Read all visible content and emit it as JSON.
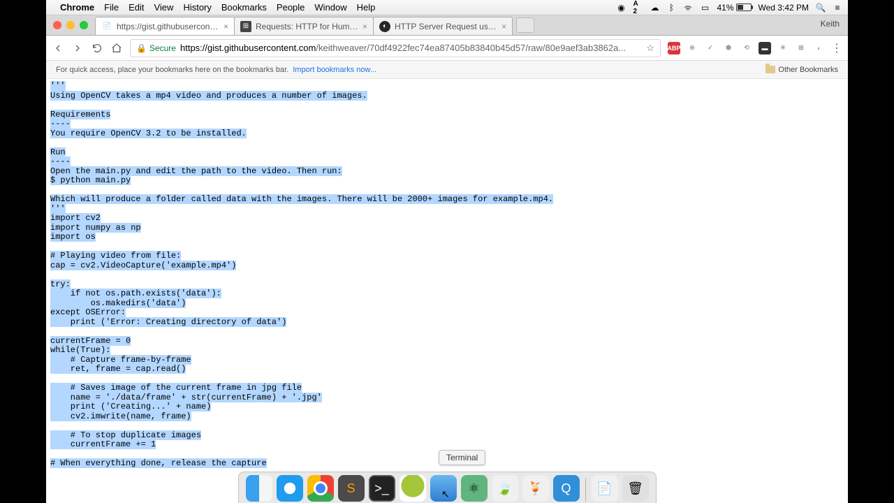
{
  "menubar": {
    "app": "Chrome",
    "items": [
      "File",
      "Edit",
      "View",
      "History",
      "Bookmarks",
      "People",
      "Window",
      "Help"
    ]
  },
  "status": {
    "battery_pct": "41%",
    "clock": "Wed 3:42 PM"
  },
  "tabs": [
    {
      "title": "https://gist.githubusercontent.",
      "active": true
    },
    {
      "title": "Requests: HTTP for Humans —",
      "active": false
    },
    {
      "title": "HTTP Server Request using Re",
      "active": false
    }
  ],
  "user_badge": "Keith",
  "nav": {
    "secure_label": "Secure",
    "url_host": "https://gist.githubusercontent.com",
    "url_path": "/keithweaver/70df4922fec74ea87405b83840b45d57/raw/80e9aef3ab3862a..."
  },
  "bookmarks": {
    "msg": "For quick access, place your bookmarks here on the bookmarks bar.",
    "link": "Import bookmarks now...",
    "other": "Other Bookmarks"
  },
  "code_lines": [
    "'''",
    "Using OpenCV takes a mp4 video and produces a number of images.",
    "",
    "Requirements",
    "----",
    "You require OpenCV 3.2 to be installed.",
    "",
    "Run",
    "----",
    "Open the main.py and edit the path to the video. Then run:",
    "$ python main.py",
    "",
    "Which will produce a folder called data with the images. There will be 2000+ images for example.mp4.",
    "'''",
    "import cv2",
    "import numpy as np",
    "import os",
    "",
    "# Playing video from file:",
    "cap = cv2.VideoCapture('example.mp4')",
    "",
    "try:",
    "    if not os.path.exists('data'):",
    "        os.makedirs('data')",
    "except OSError:",
    "    print ('Error: Creating directory of data')",
    "",
    "currentFrame = 0",
    "while(True):",
    "    # Capture frame-by-frame",
    "    ret, frame = cap.read()",
    "",
    "    # Saves image of the current frame in jpg file",
    "    name = './data/frame' + str(currentFrame) + '.jpg'",
    "    print ('Creating...' + name)",
    "    cv2.imwrite(name, frame)",
    "",
    "    # To stop duplicate images",
    "    currentFrame += 1",
    "",
    "# When everything done, release the capture"
  ],
  "dock": {
    "tooltip": "Terminal",
    "items": [
      "finder",
      "safari",
      "chrome",
      "sublime",
      "terminal",
      "android-studio",
      "xcode",
      "atom",
      "mongodb",
      "handbrake",
      "quicktime",
      "pages",
      "trash"
    ]
  }
}
